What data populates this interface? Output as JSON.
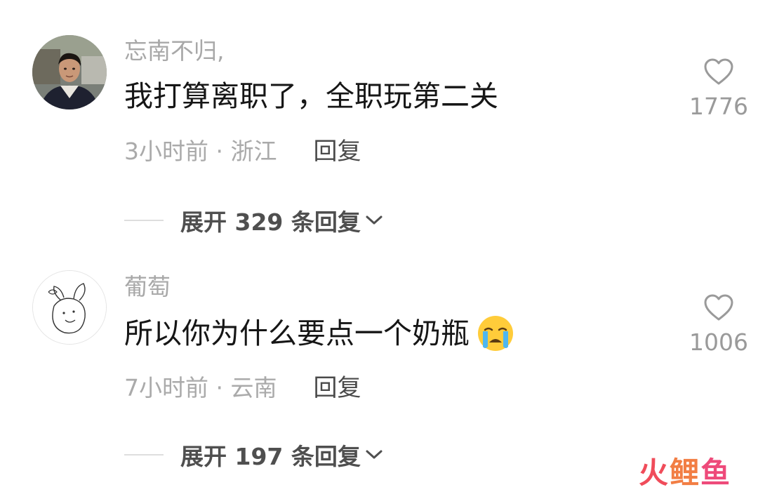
{
  "comments": [
    {
      "username": "忘南不归,",
      "text": "我打算离职了，全职玩第二关",
      "time_location": "3小时前 · 浙江",
      "reply_label": "回复",
      "like_count": "1776",
      "expand_label": "展开 329 条回复",
      "has_emoji": false
    },
    {
      "username": "葡萄",
      "text": "所以你为什么要点一个奶瓶",
      "emoji_icon": "crying-face-icon",
      "time_location": "7小时前 · 云南",
      "reply_label": "回复",
      "like_count": "1006",
      "expand_label": "展开 197 条回复",
      "has_emoji": true
    }
  ],
  "watermark": {
    "text": "火鲤鱼",
    "colors": [
      "#f04c5a",
      "#f27e44",
      "#ee4a7a"
    ]
  },
  "colors": {
    "username": "#a8a8a8",
    "body_text": "#161616",
    "meta_text": "#aaaaaa",
    "reply": "#4a4a4a",
    "like_count": "#9a9a9a",
    "expand": "#4f4f4f"
  }
}
